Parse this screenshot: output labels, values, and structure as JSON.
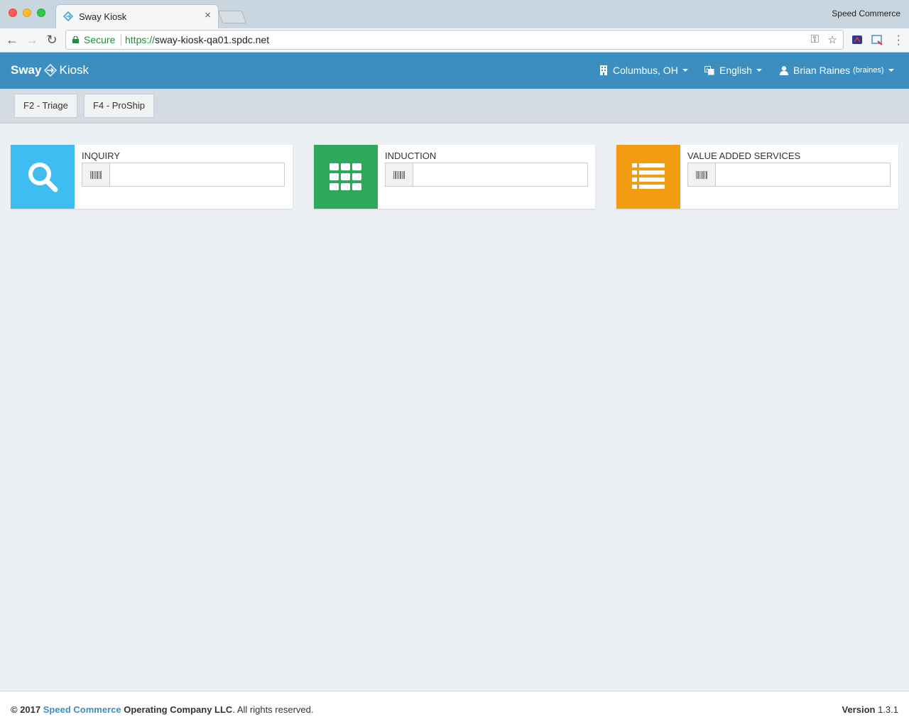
{
  "browser": {
    "tab_title": "Sway Kiosk",
    "profile_name": "Speed Commerce",
    "secure_label": "Secure",
    "url_scheme": "https://",
    "url_host": "sway-kiosk-qa01.spdc.net"
  },
  "navbar": {
    "brand_sway": "Sway",
    "brand_kiosk": "Kiosk",
    "location": "Columbus, OH",
    "language": "English",
    "user_name": "Brian Raines",
    "user_login": "(braines)"
  },
  "hotkeys": [
    {
      "label": "F2 - Triage"
    },
    {
      "label": "F4 - ProShip"
    }
  ],
  "cards": [
    {
      "title": "INQUIRY",
      "color": "#3fbdf0",
      "icon": "search-icon",
      "value": ""
    },
    {
      "title": "INDUCTION",
      "color": "#2fa85a",
      "icon": "grid-icon",
      "value": ""
    },
    {
      "title": "VALUE ADDED SERVICES",
      "color": "#f39c12",
      "icon": "list-icon",
      "value": ""
    }
  ],
  "footer": {
    "copyright": "© 2017",
    "company_link": "Speed Commerce",
    "company_rest": "Operating Company LLC",
    "rights": ". All rights reserved.",
    "version_label": "Version",
    "version_number": "1.3.1"
  },
  "colors": {
    "navbar": "#3d8ec0",
    "background": "#ecf0f4"
  }
}
